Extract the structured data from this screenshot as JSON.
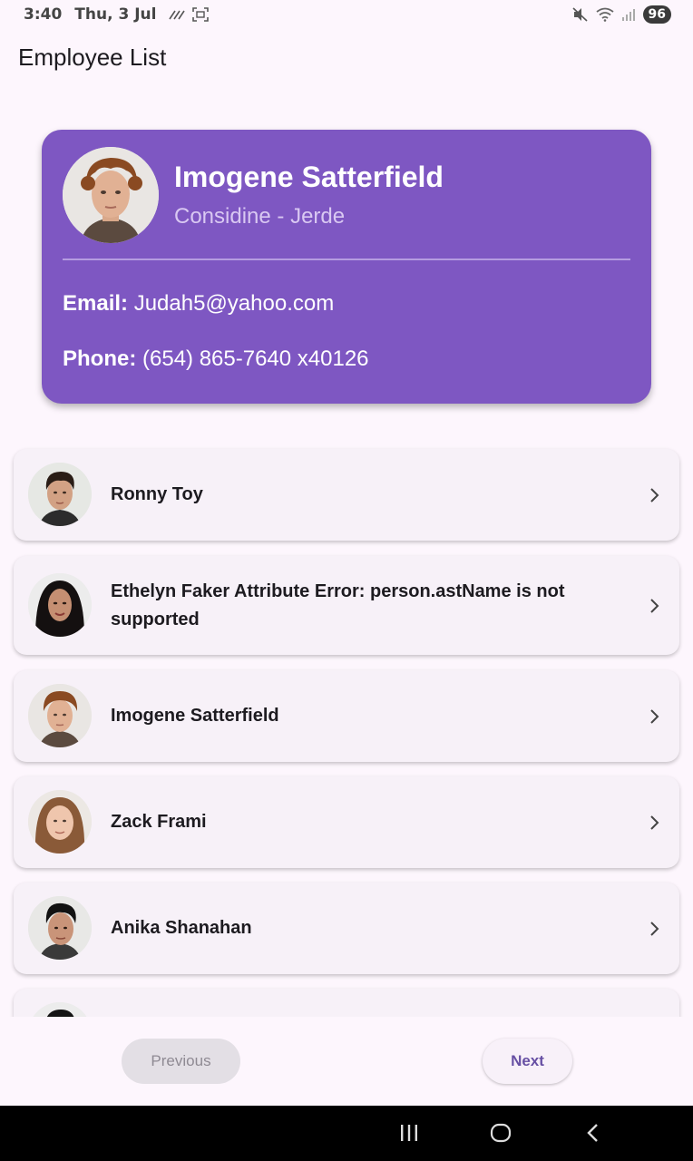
{
  "status": {
    "time": "3:40",
    "date": "Thu, 3 Jul",
    "battery": "96"
  },
  "app_title": "Employee List",
  "selected": {
    "name": "Imogene Satterfield",
    "company": "Considine - Jerde",
    "email_label": "Email:",
    "email": "Judah5@yahoo.com",
    "phone_label": "Phone:",
    "phone": "(654) 865-7640 x40126"
  },
  "employees": [
    {
      "name": "Ronny Toy",
      "avatar": "portrait-man-dark-hair"
    },
    {
      "name": "Ethelyn Faker Attribute Error: person.astName is not supported",
      "avatar": "portrait-woman-dark-hair"
    },
    {
      "name": "Imogene Satterfield",
      "avatar": "portrait-man-curly-hair"
    },
    {
      "name": "Zack Frami",
      "avatar": "portrait-woman-brown-hair"
    },
    {
      "name": "Anika Shanahan",
      "avatar": "portrait-man-black-hair"
    }
  ],
  "pagination": {
    "previous_label": "Previous",
    "next_label": "Next",
    "previous_enabled": false
  },
  "colors": {
    "background": "#fdf6fd",
    "card_accent": "#7e57c2",
    "list_card": "#f7f1f8",
    "button_text": "#6750a4"
  }
}
